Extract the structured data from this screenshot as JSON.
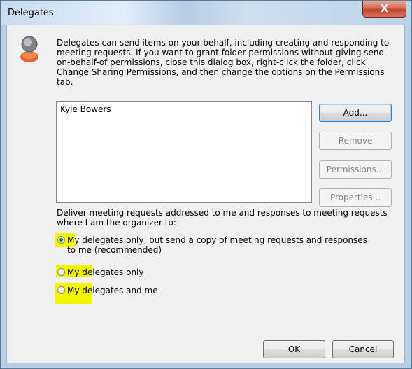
{
  "window": {
    "title": "Delegates",
    "close_label": "X"
  },
  "intro_text": "Delegates can send items on your behalf, including creating and responding to meeting requests. If you want to grant folder permissions without giving send-on-behalf-of permissions, close this dialog box, right-click the folder, click Change Sharing Permissions, and then change the options on the Permissions tab.",
  "delegates_list": [
    "Kyle Bowers"
  ],
  "buttons": {
    "add": "Add...",
    "remove": "Remove",
    "permissions": "Permissions...",
    "properties": "Properties...",
    "ok": "OK",
    "cancel": "Cancel"
  },
  "deliver_label": "Deliver meeting requests addressed to me and responses to meeting requests where I am the organizer to:",
  "options": [
    {
      "line1": "My delegates only, but send a copy of meeting requests and responses",
      "line2": "to me (recommended)",
      "checked": true
    },
    {
      "line1": "My delegates only",
      "checked": false
    },
    {
      "line1": "My delegates and me",
      "checked": false
    }
  ],
  "colors": {
    "highlight": "#f3f400",
    "radio_checked": "#1a8a1a"
  }
}
